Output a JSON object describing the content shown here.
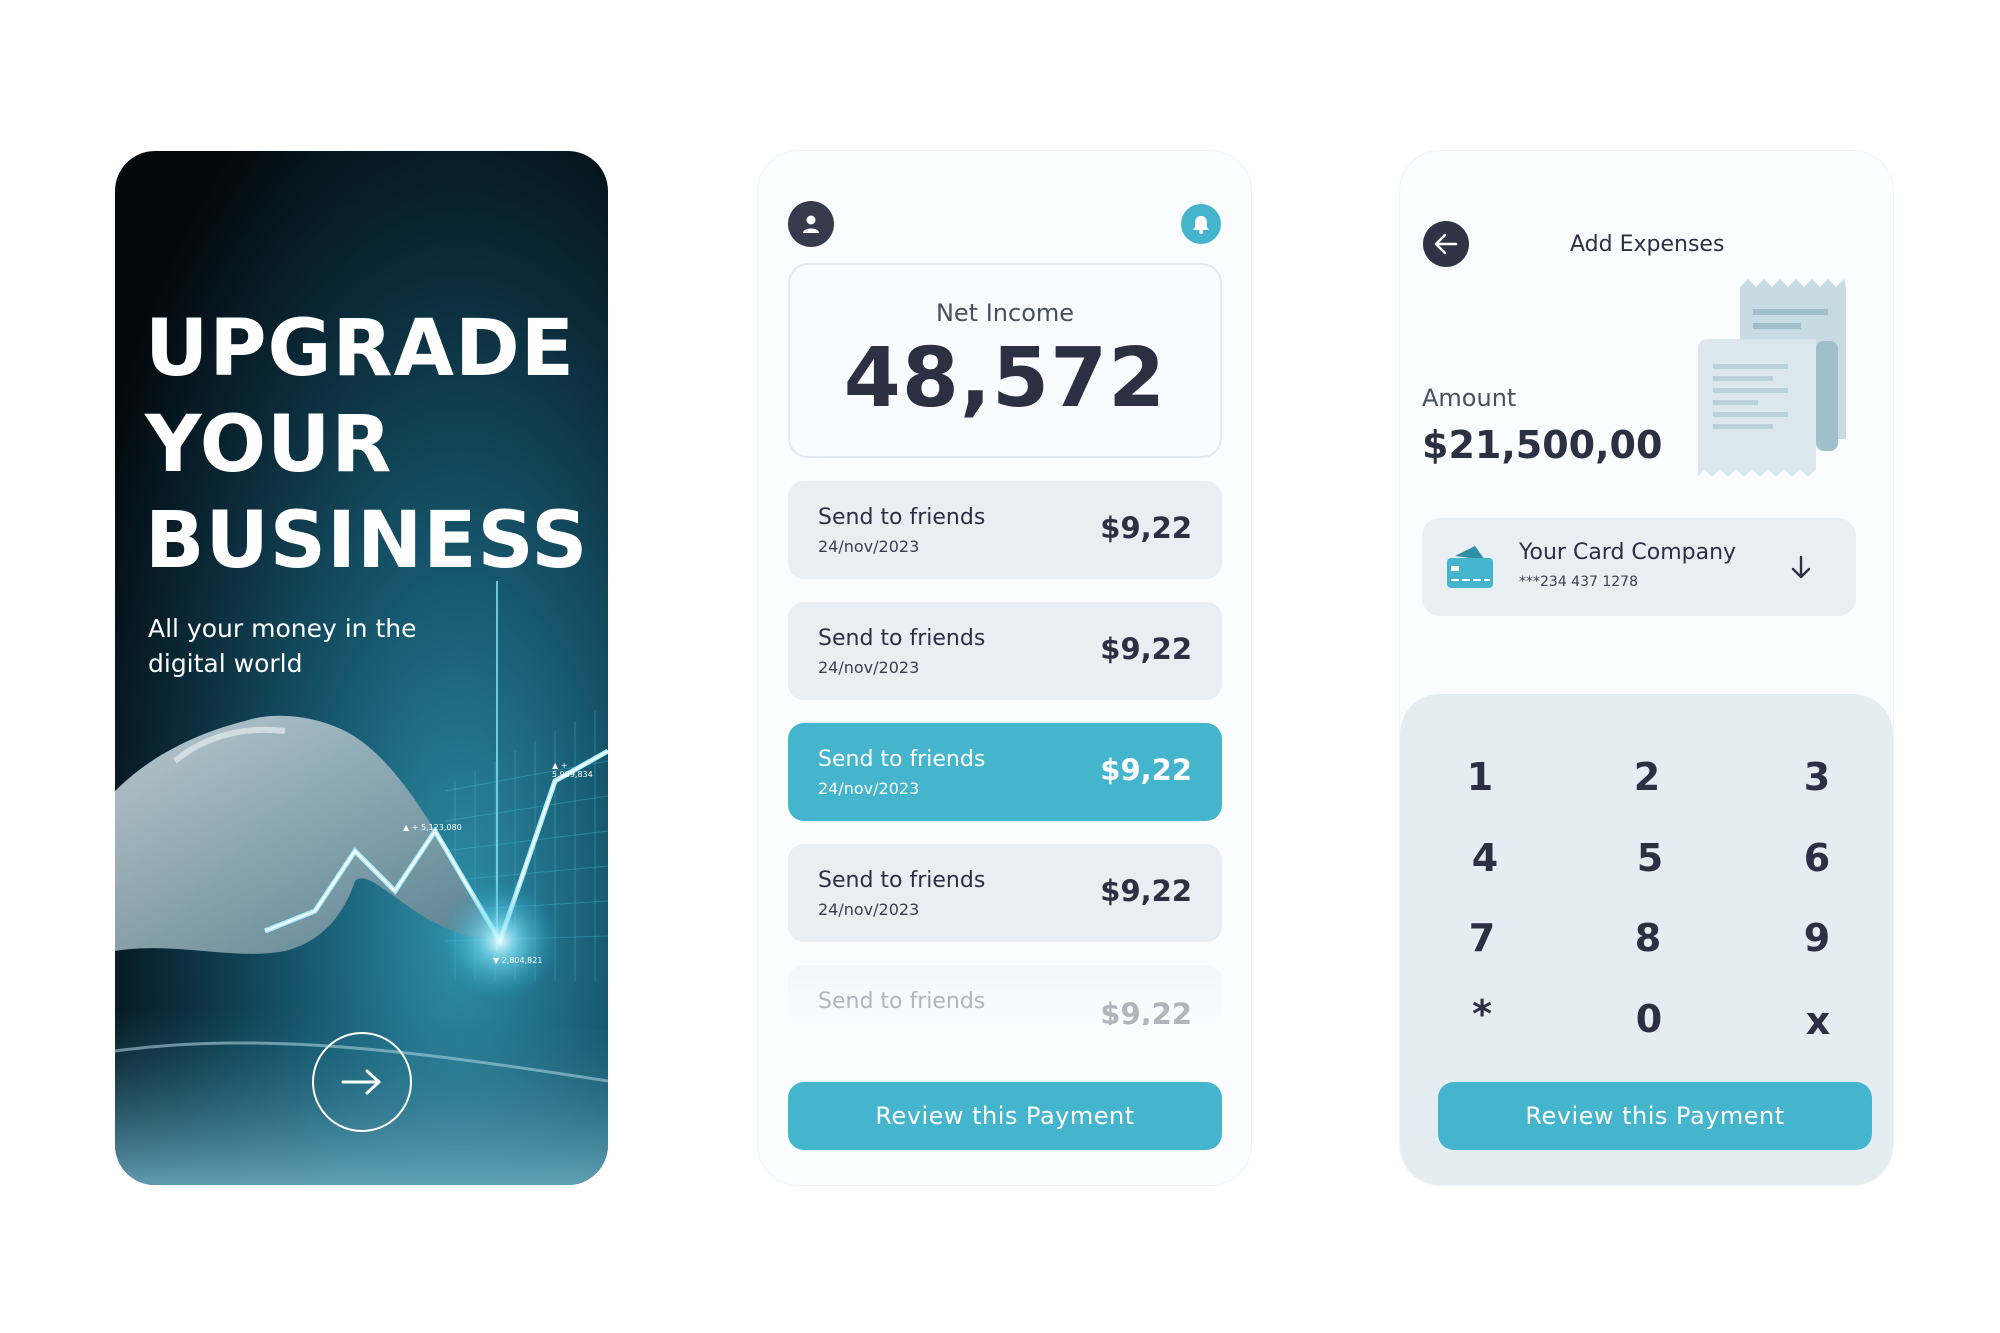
{
  "onboarding": {
    "headline": [
      "UPGRADE",
      "YOUR",
      "BUSINESS"
    ],
    "subtitle_line1": "All your money in the",
    "subtitle_line2": "digital world",
    "chart_labels": [
      "▲ + 5,989,834",
      "▲ + 5,123,080",
      "▼ 2,804,821"
    ]
  },
  "dashboard": {
    "net_income_label": "Net Income",
    "net_income_value": "48,572",
    "transactions": [
      {
        "title": "Send to friends",
        "date": "24/nov/2023",
        "amount": "$9,22",
        "active": false
      },
      {
        "title": "Send to friends",
        "date": "24/nov/2023",
        "amount": "$9,22",
        "active": false
      },
      {
        "title": "Send to friends",
        "date": "24/nov/2023",
        "amount": "$9,22",
        "active": true
      },
      {
        "title": "Send to friends",
        "date": "24/nov/2023",
        "amount": "$9,22",
        "active": false
      },
      {
        "title": "Send to friends",
        "date": "",
        "amount": "$9,22",
        "active": false
      }
    ],
    "review_button": "Review this Payment"
  },
  "expenses": {
    "title": "Add Expenses",
    "amount_label": "Amount",
    "amount_value": "$21,500,00",
    "card_name": "Your Card Company",
    "card_number": "***234 437 1278",
    "keys": [
      "1",
      "2",
      "3",
      "4",
      "5",
      "6",
      "7",
      "8",
      "9",
      "*",
      "0",
      "x"
    ],
    "review_button": "Review this Payment"
  },
  "colors": {
    "accent": "#45b5cd",
    "dark": "#2b3042",
    "card_bg": "#e8eef1"
  }
}
